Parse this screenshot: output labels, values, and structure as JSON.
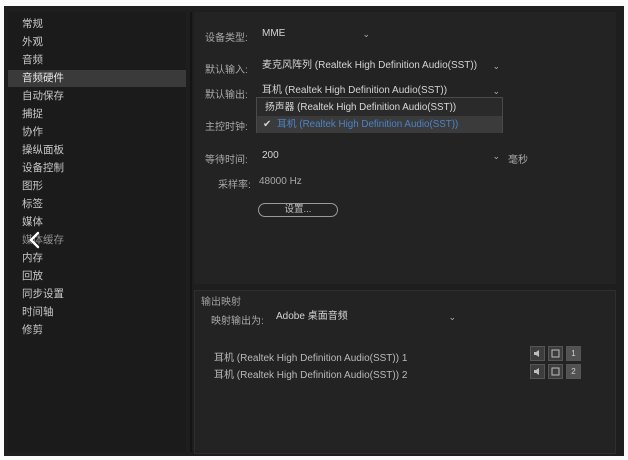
{
  "sidebar": {
    "items": [
      {
        "label": "常规"
      },
      {
        "label": "外观"
      },
      {
        "label": "音频"
      },
      {
        "label": "音频硬件",
        "active": true
      },
      {
        "label": "自动保存"
      },
      {
        "label": "捕捉"
      },
      {
        "label": "协作"
      },
      {
        "label": "操纵面板"
      },
      {
        "label": "设备控制"
      },
      {
        "label": "图形"
      },
      {
        "label": "标签"
      },
      {
        "label": "媒体"
      },
      {
        "label": "媒体缓存"
      },
      {
        "label": "内存"
      },
      {
        "label": "回放"
      },
      {
        "label": "同步设置"
      },
      {
        "label": "时间轴"
      },
      {
        "label": "修剪"
      }
    ]
  },
  "hardware": {
    "device_type_label": "设备类型:",
    "device_type_value": "MME",
    "default_input_label": "默认输入:",
    "default_input_value": "麦克风阵列 (Realtek High Definition Audio(SST))",
    "default_output_label": "默认输出:",
    "default_output_value": "耳机 (Realtek High Definition Audio(SST))",
    "output_options": [
      "扬声器 (Realtek High Definition Audio(SST))",
      "耳机 (Realtek High Definition Audio(SST))"
    ],
    "master_clock_label": "主控时钟:",
    "latency_label": "等待时间:",
    "latency_value": "200",
    "latency_unit": "毫秒",
    "sample_rate_label": "采样率:",
    "sample_rate_value": "48000 Hz",
    "setup_button": "设置..."
  },
  "output_mapping": {
    "title": "输出映射",
    "map_to_label": "映射输出为:",
    "map_to_value": "Adobe 桌面音频",
    "channels": [
      {
        "name": "耳机 (Realtek High Definition Audio(SST)) 1",
        "number": "1"
      },
      {
        "name": "耳机 (Realtek High Definition Audio(SST)) 2",
        "number": "2"
      }
    ]
  },
  "icons": {
    "back": "chevron-left-icon",
    "caret": "chevron-down-icon",
    "check": "checkmark-icon",
    "speaker": "speaker-icon",
    "clip": "clip-icon"
  }
}
